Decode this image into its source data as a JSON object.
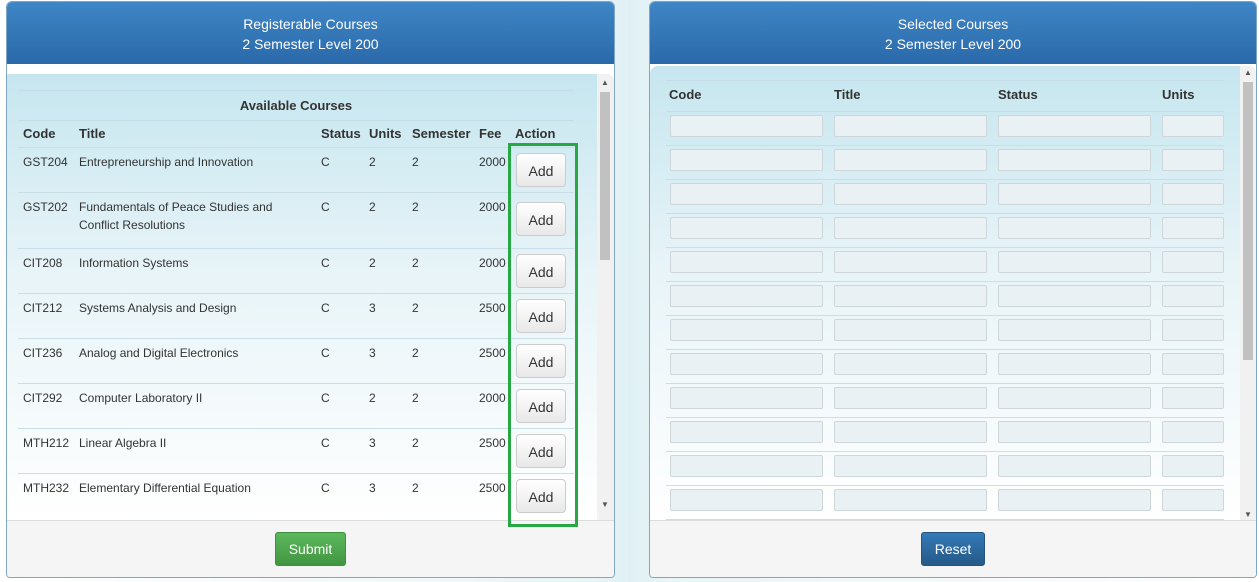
{
  "left": {
    "title": "Registerable Courses",
    "subtitle": "2 Semester Level 200",
    "caption": "Available Courses",
    "columns": [
      "Code",
      "Title",
      "Status",
      "Units",
      "Semester",
      "Fee",
      "Action"
    ],
    "courses": [
      {
        "code": "GST204",
        "title": "Entrepreneurship and Innovation",
        "status": "C",
        "units": "2",
        "semester": "2",
        "fee": "2000",
        "action": "Add"
      },
      {
        "code": "GST202",
        "title": "Fundamentals of Peace Studies and Conflict Resolutions",
        "status": "C",
        "units": "2",
        "semester": "2",
        "fee": "2000",
        "action": "Add"
      },
      {
        "code": "CIT208",
        "title": "Information Systems",
        "status": "C",
        "units": "2",
        "semester": "2",
        "fee": "2000",
        "action": "Add"
      },
      {
        "code": "CIT212",
        "title": "Systems Analysis and Design",
        "status": "C",
        "units": "3",
        "semester": "2",
        "fee": "2500",
        "action": "Add"
      },
      {
        "code": "CIT236",
        "title": "Analog and Digital Electronics",
        "status": "C",
        "units": "3",
        "semester": "2",
        "fee": "2500",
        "action": "Add"
      },
      {
        "code": "CIT292",
        "title": "Computer Laboratory II",
        "status": "C",
        "units": "2",
        "semester": "2",
        "fee": "2000",
        "action": "Add"
      },
      {
        "code": "MTH212",
        "title": "Linear Algebra II",
        "status": "C",
        "units": "3",
        "semester": "2",
        "fee": "2500",
        "action": "Add"
      },
      {
        "code": "MTH232",
        "title": "Elementary Differential Equation",
        "status": "C",
        "units": "3",
        "semester": "2",
        "fee": "2500",
        "action": "Add"
      }
    ],
    "submit_label": "Submit"
  },
  "right": {
    "title": "Selected Courses",
    "subtitle": "2 Semester Level 200",
    "columns": [
      "Code",
      "Title",
      "Status",
      "Units"
    ],
    "rows": [
      [
        "",
        "",
        "",
        ""
      ],
      [
        "",
        "",
        "",
        ""
      ],
      [
        "",
        "",
        "",
        ""
      ],
      [
        "",
        "",
        "",
        ""
      ],
      [
        "",
        "",
        "",
        ""
      ],
      [
        "",
        "",
        "",
        ""
      ],
      [
        "",
        "",
        "",
        ""
      ],
      [
        "",
        "",
        "",
        ""
      ],
      [
        "",
        "",
        "",
        ""
      ],
      [
        "",
        "",
        "",
        ""
      ],
      [
        "",
        "",
        "",
        ""
      ],
      [
        "",
        "",
        "",
        ""
      ]
    ],
    "reset_label": "Reset"
  },
  "colors": {
    "header_blue": "#2f72b3",
    "highlight_green": "#28a745",
    "submit_green": "#4cae4c",
    "reset_blue": "#2e6da4"
  }
}
